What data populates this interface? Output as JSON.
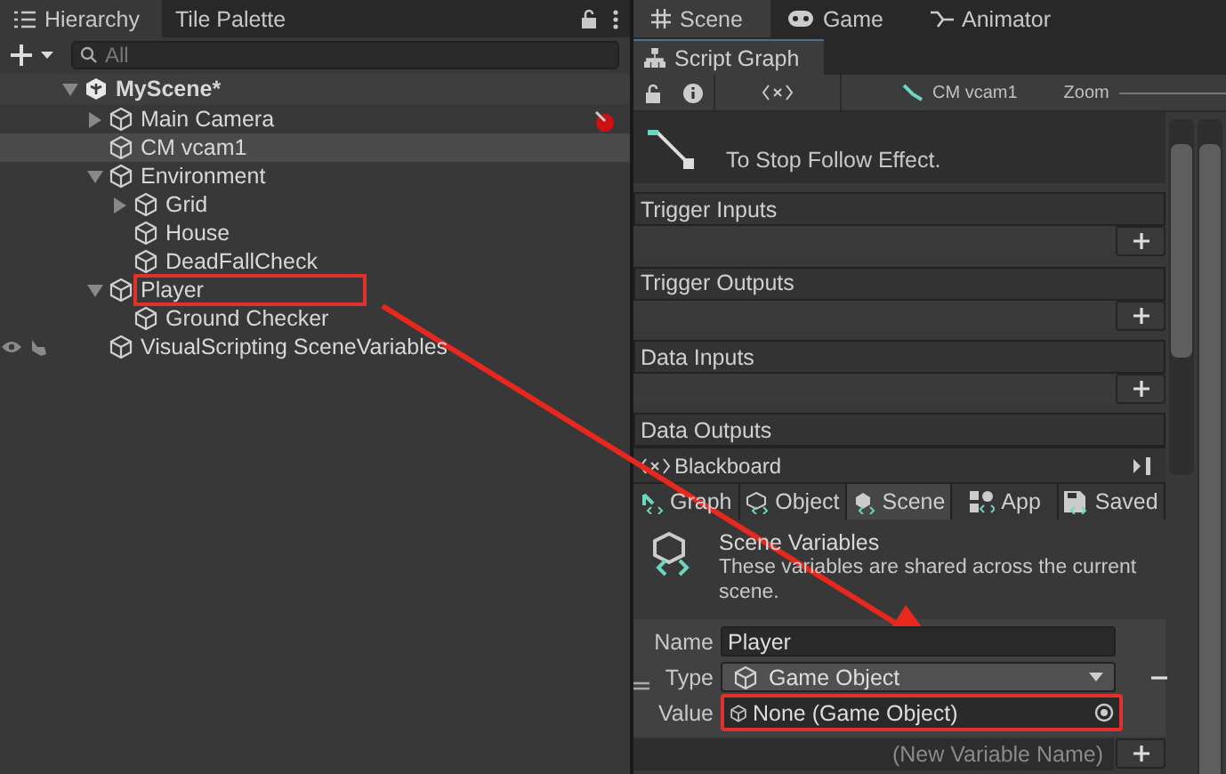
{
  "hierarchy": {
    "tabs": [
      {
        "label": "Hierarchy",
        "selected": true
      },
      {
        "label": "Tile Palette",
        "selected": false
      }
    ],
    "search": {
      "placeholder": "All"
    },
    "tree": [
      {
        "label": "MyScene*",
        "kind": "scene",
        "expanded": true,
        "selected": false,
        "highlighted": false,
        "children": [
          {
            "label": "Main Camera",
            "kind": "object",
            "expanded": false,
            "selected": false,
            "highlighted": false,
            "badge": true
          },
          {
            "label": "CM vcam1",
            "kind": "object",
            "selected": true,
            "highlighted": false
          },
          {
            "label": "Environment",
            "kind": "object",
            "expanded": true,
            "selected": false,
            "highlighted": false,
            "children": [
              {
                "label": "Grid",
                "kind": "object",
                "expanded": false,
                "selected": false,
                "highlighted": false
              },
              {
                "label": "House",
                "kind": "object",
                "selected": false,
                "highlighted": false
              },
              {
                "label": "DeadFallCheck",
                "kind": "object",
                "selected": false,
                "highlighted": false
              }
            ]
          },
          {
            "label": "Player",
            "kind": "object",
            "expanded": true,
            "selected": false,
            "highlighted": true,
            "children": [
              {
                "label": "Ground Checker",
                "kind": "object",
                "selected": false,
                "highlighted": false
              }
            ]
          },
          {
            "label": "VisualScripting SceneVariables",
            "kind": "object",
            "selected": false,
            "highlighted": false,
            "visibility_icons": true
          }
        ]
      }
    ]
  },
  "view_tabs": [
    {
      "label": "Scene",
      "kind": "scene",
      "selected": true
    },
    {
      "label": "Game",
      "kind": "game",
      "selected": false
    },
    {
      "label": "Animator",
      "kind": "animator",
      "selected": false
    }
  ],
  "script_graph": {
    "title": "Script Graph",
    "target": "CM vcam1",
    "zoom_label": "Zoom",
    "node_description": "To Stop Follow Effect.",
    "sections": [
      "Trigger Inputs",
      "Trigger Outputs",
      "Data Inputs",
      "Data Outputs"
    ]
  },
  "blackboard": {
    "title": "Blackboard",
    "tabs": [
      {
        "label": "Graph",
        "kind": "graph",
        "selected": false
      },
      {
        "label": "Object",
        "kind": "object",
        "selected": false
      },
      {
        "label": "Scene",
        "kind": "scene",
        "selected": true
      },
      {
        "label": "App",
        "kind": "app",
        "selected": false
      },
      {
        "label": "Saved",
        "kind": "saved",
        "selected": false
      }
    ],
    "heading": "Scene Variables",
    "description": "These variables are shared across the current scene.",
    "variable": {
      "name_label": "Name",
      "name": "Player",
      "type_label": "Type",
      "type": "Game Object",
      "value_label": "Value",
      "value": "None (Game Object)",
      "value_highlighted": true
    },
    "new_variable": {
      "placeholder": "(New Variable Name)"
    }
  },
  "annotation_arrow": true
}
